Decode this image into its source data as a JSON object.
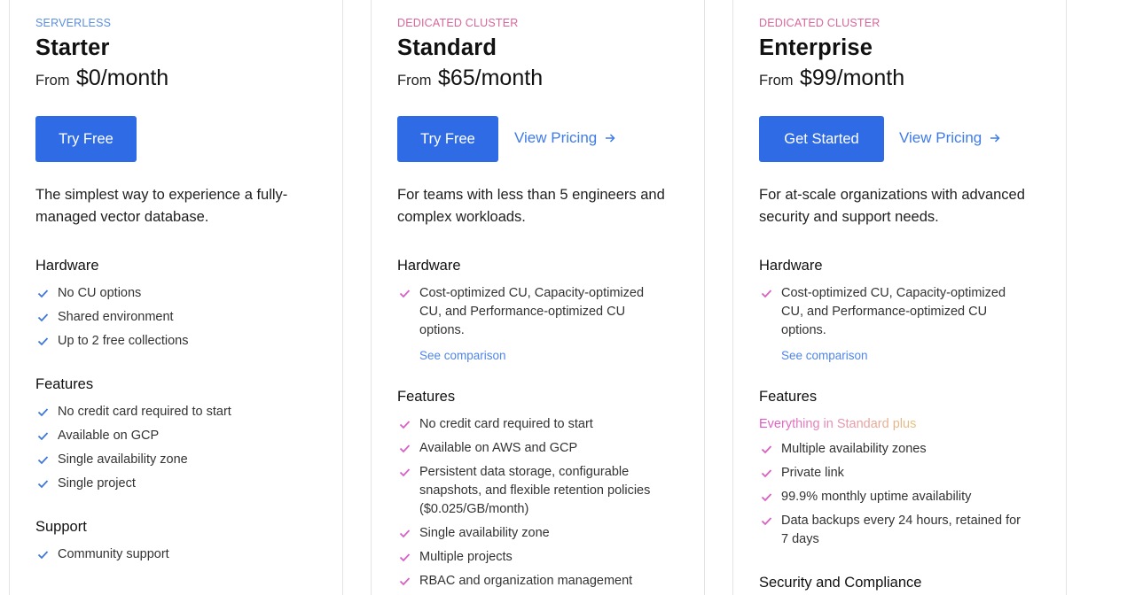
{
  "plans": [
    {
      "tier": "SERVERLESS",
      "name": "Starter",
      "price_prefix": "From",
      "price": "$0/month",
      "primary_button": "Try Free",
      "description": "The simplest way to experience a fully-managed vector database.",
      "hardware_title": "Hardware",
      "hardware": [
        "No CU options",
        "Shared environment",
        "Up to 2 free collections"
      ],
      "features_title": "Features",
      "features": [
        "No credit card required to start",
        "Available on GCP",
        "Single availability zone",
        "Single project"
      ],
      "support_title": "Support",
      "support": [
        "Community support"
      ]
    },
    {
      "tier": "DEDICATED CLUSTER",
      "name": "Standard",
      "price_prefix": "From",
      "price": "$65/month",
      "primary_button": "Try Free",
      "secondary_link": "View Pricing",
      "description": "For teams with less than 5 engineers and complex workloads.",
      "hardware_title": "Hardware",
      "hardware": [
        "Cost-optimized CU, Capacity-optimized CU, and Performance-optimized CU options."
      ],
      "see_comparison": "See comparison",
      "features_title": "Features",
      "features": [
        "No credit card required to start",
        "Available on AWS and GCP",
        "Persistent data storage, configurable snapshots, and flexible retention policies ($0.025/GB/month)",
        "Single availability zone",
        "Multiple projects",
        "RBAC and organization management"
      ]
    },
    {
      "tier": "DEDICATED CLUSTER",
      "name": "Enterprise",
      "price_prefix": "From",
      "price": "$99/month",
      "primary_button": "Get Started",
      "secondary_link": "View Pricing",
      "description": "For at-scale organizations with advanced security and support needs.",
      "hardware_title": "Hardware",
      "hardware": [
        "Cost-optimized CU, Capacity-optimized CU, and Performance-optimized CU options."
      ],
      "see_comparison": "See comparison",
      "features_title": "Features",
      "features_intro": "Everything in Standard plus",
      "features": [
        "Multiple availability zones",
        "Private link",
        "99.9% monthly uptime availability",
        "Data backups every 24 hours, retained for 7 days"
      ],
      "security_title": "Security and Compliance"
    }
  ],
  "colors": {
    "primary_button": "#2f6be5",
    "link": "#3e7bea",
    "serverless_tier": "#5b8fe0",
    "dedicated_tier": "#d9669a",
    "check_blue": "#3f78d8",
    "check_pink": "#d860c6"
  },
  "icons": {
    "check": "check-icon",
    "arrow": "arrow-right-icon"
  }
}
